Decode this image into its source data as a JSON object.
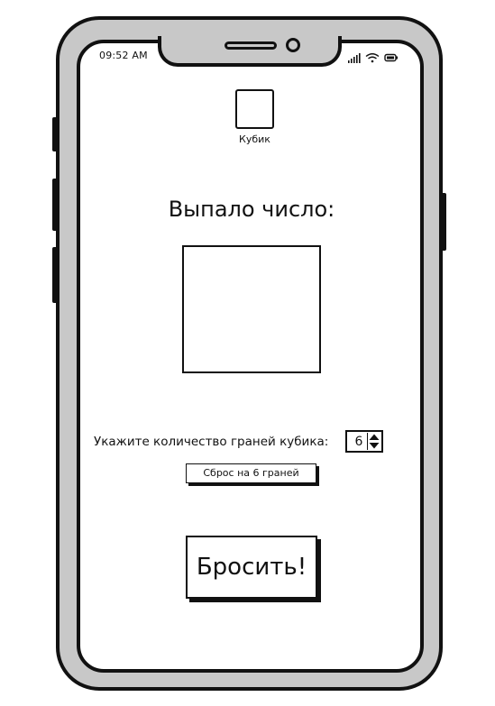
{
  "status_bar": {
    "time": "09:52 AM",
    "icons": [
      "signal-icon",
      "wifi-icon",
      "battery-icon"
    ]
  },
  "app_icon": {
    "label": "Кубик"
  },
  "result": {
    "title": "Выпало число:",
    "value": ""
  },
  "faces": {
    "label": "Укажите количество граней кубика:",
    "value": "6"
  },
  "reset_button": {
    "label": "Сброс на 6 граней"
  },
  "roll_button": {
    "label": "Бросить!"
  },
  "colors": {
    "frame": "#c8c8c8",
    "ink": "#111111",
    "screen": "#ffffff"
  }
}
